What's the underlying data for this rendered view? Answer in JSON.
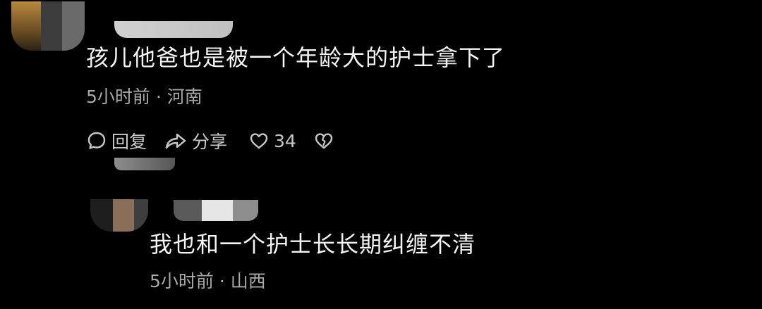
{
  "comments": [
    {
      "text": "孩儿他爸也是被一个年龄大的护士拿下了",
      "meta": "5小时前 · 河南",
      "actions": {
        "reply_label": "回复",
        "share_label": "分享",
        "like_count": "34"
      }
    },
    {
      "text": "我也和一个护士长长期纠缠不清",
      "meta": "5小时前 · 山西"
    }
  ],
  "icons": {
    "reply": "comment-bubble-icon",
    "share": "share-arrow-icon",
    "like": "heart-icon",
    "dislike": "broken-heart-icon"
  },
  "colors": {
    "background": "#000000",
    "text": "#f4f4f4",
    "meta": "#a9a9a9"
  }
}
